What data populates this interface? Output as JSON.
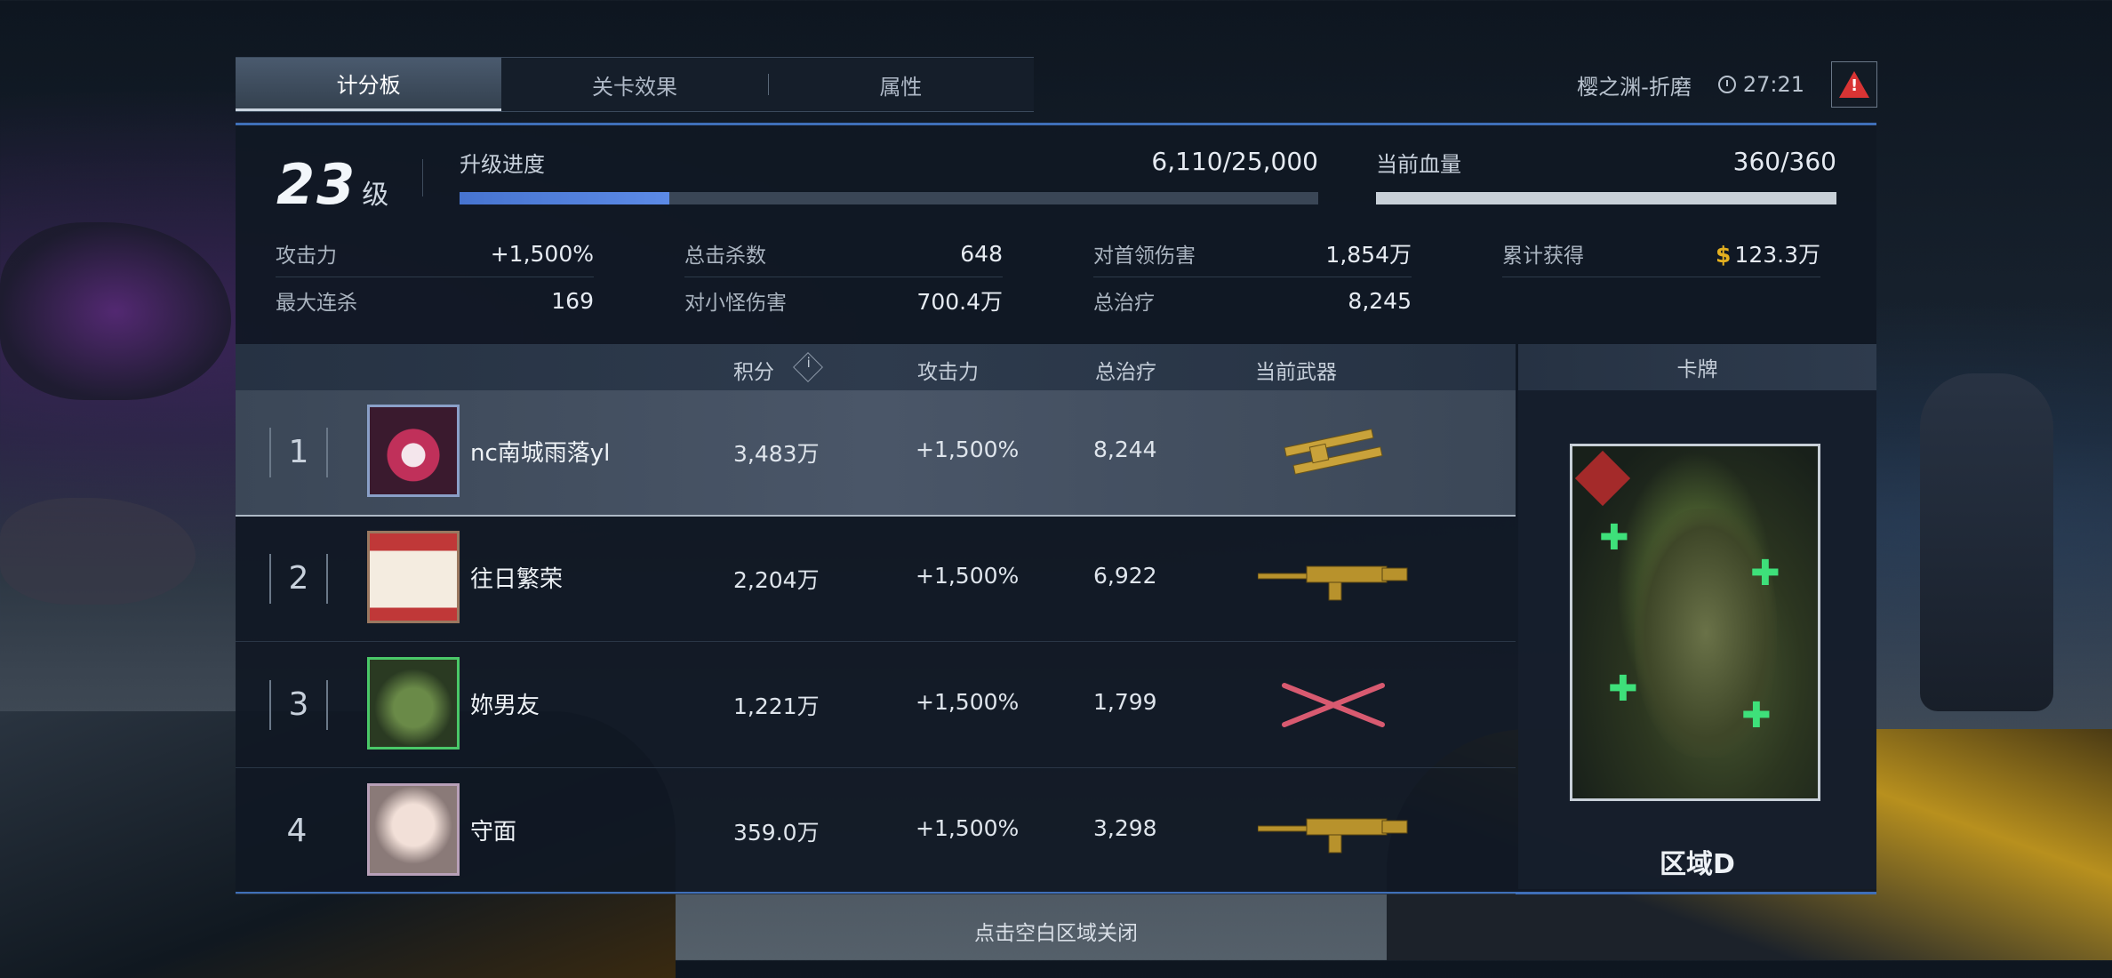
{
  "tabs": [
    "计分板",
    "关卡效果",
    "属性"
  ],
  "header": {
    "location": "樱之渊-折磨",
    "time": "27:21"
  },
  "summary": {
    "level": "23",
    "level_unit": "级",
    "progress_label": "升级进度",
    "progress_value": "6,110/25,000",
    "progress_fraction": 0.2444,
    "hp_label": "当前血量",
    "hp_value": "360/360",
    "hp_fraction": 1.0
  },
  "stats": {
    "attack": {
      "label": "攻击力",
      "value": "+1,500%"
    },
    "max_combo": {
      "label": "最大连杀",
      "value": "169"
    },
    "total_kills": {
      "label": "总击杀数",
      "value": "648"
    },
    "minion_damage": {
      "label": "对小怪伤害",
      "value": "700.4万"
    },
    "boss_damage": {
      "label": "对首领伤害",
      "value": "1,854万"
    },
    "total_heal": {
      "label": "总治疗",
      "value": "8,245"
    },
    "earned": {
      "label": "累计获得",
      "currency": "$",
      "value": "123.3万"
    }
  },
  "table": {
    "columns": [
      "积分",
      "攻击力",
      "总治疗",
      "当前武器"
    ],
    "rows": [
      {
        "rank": "1",
        "name": "nc南城雨落yl",
        "score": "3,483万",
        "attack": "+1,500%",
        "heal": "8,244",
        "weapon": "dual-rifle-icon"
      },
      {
        "rank": "2",
        "name": "往日繁荣",
        "score": "2,204万",
        "attack": "+1,500%",
        "heal": "6,922",
        "weapon": "gold-rifle-icon"
      },
      {
        "rank": "3",
        "name": "妳男友",
        "score": "1,221万",
        "attack": "+1,500%",
        "heal": "1,799",
        "weapon": "crossed-blades-icon"
      },
      {
        "rank": "4",
        "name": "守面",
        "score": "359.0万",
        "attack": "+1,500%",
        "heal": "3,298",
        "weapon": "gold-rifle-icon"
      }
    ]
  },
  "card": {
    "header": "卡牌",
    "label": "区域D"
  },
  "footer": {
    "close_hint": "点击空白区域关闭"
  },
  "colors": {
    "accent_blue": "#4774d0",
    "warning_red": "#d93434",
    "money_gold": "#e4b020"
  }
}
